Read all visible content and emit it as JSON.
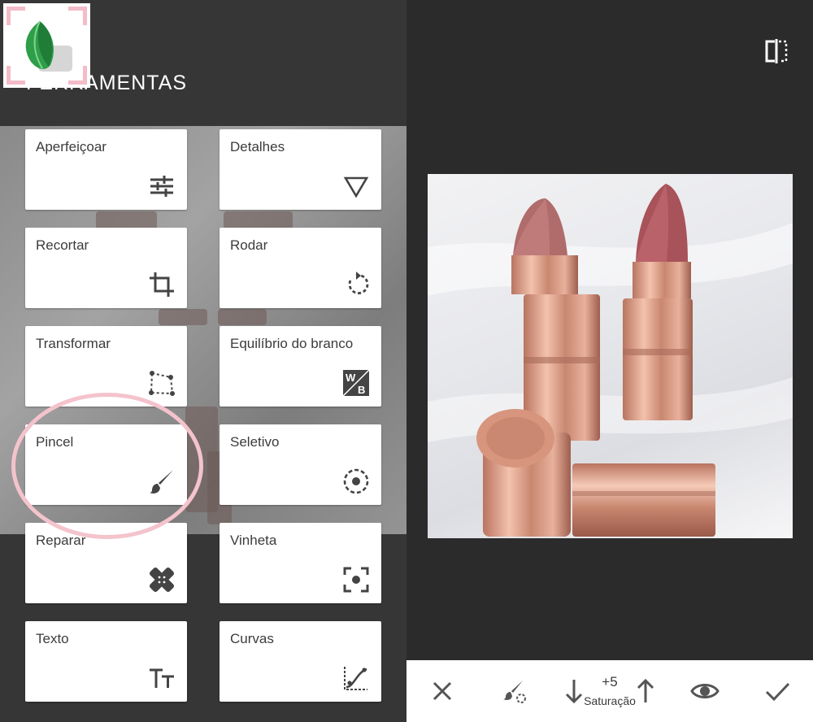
{
  "title": "FERRAMENTAS",
  "tools": [
    {
      "label": "Aperfeiçoar",
      "icon": "tune-icon"
    },
    {
      "label": "Detalhes",
      "icon": "triangle-icon"
    },
    {
      "label": "Recortar",
      "icon": "crop-icon"
    },
    {
      "label": "Rodar",
      "icon": "rotate-icon"
    },
    {
      "label": "Transformar",
      "icon": "perspective-icon"
    },
    {
      "label": "Equilíbrio do branco",
      "icon": "white-balance-icon"
    },
    {
      "label": "Pincel",
      "icon": "brush-icon"
    },
    {
      "label": "Seletivo",
      "icon": "selective-icon"
    },
    {
      "label": "Reparar",
      "icon": "healing-icon"
    },
    {
      "label": "Vinheta",
      "icon": "vignette-icon"
    },
    {
      "label": "Texto",
      "icon": "text-icon"
    },
    {
      "label": "Curvas",
      "icon": "curves-icon"
    }
  ],
  "adjust": {
    "value": "+5",
    "label": "Saturação"
  },
  "colors": {
    "highlight_circle": "#f4c3cc",
    "logo_green": "#2e9e48"
  }
}
